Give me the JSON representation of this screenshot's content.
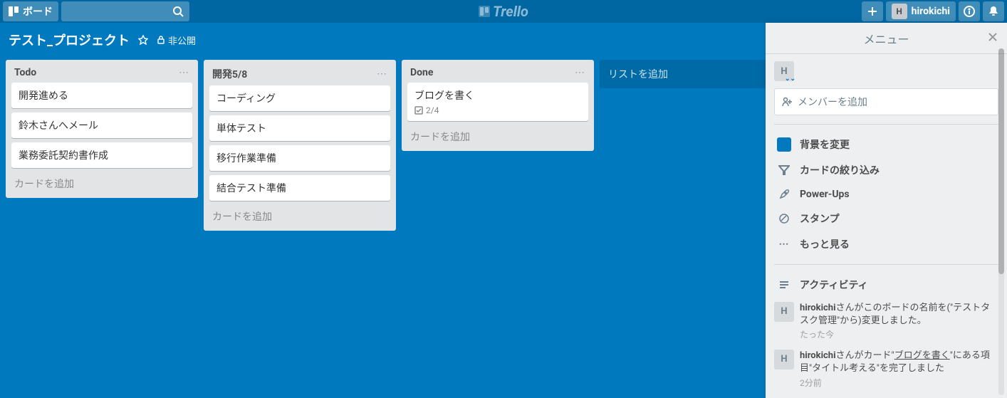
{
  "header": {
    "boards_btn": "ボード",
    "logo": "Trello",
    "user_initial": "H",
    "username": "hirokichi"
  },
  "board_header": {
    "title": "テスト_プロジェクト",
    "privacy": "非公開"
  },
  "lists": [
    {
      "title": "Todo",
      "cards": [
        {
          "text": "開発進める"
        },
        {
          "text": "鈴木さんへメール"
        },
        {
          "text": "業務委託契約書作成"
        }
      ],
      "add_label": "カードを追加"
    },
    {
      "title": "開発5/8",
      "cards": [
        {
          "text": "コーディング"
        },
        {
          "text": "単体テスト"
        },
        {
          "text": "移行作業準備"
        },
        {
          "text": "結合テスト準備"
        }
      ],
      "add_label": "カードを追加"
    },
    {
      "title": "Done",
      "cards": [
        {
          "text": "ブログを書く",
          "checklist": "2/4"
        }
      ],
      "add_label": "カードを追加"
    }
  ],
  "add_list_label": "リストを追加",
  "menu": {
    "title": "メニュー",
    "member_initial": "H",
    "add_member": "メンバーを追加",
    "items": {
      "background": "背景を変更",
      "filter": "カードの絞り込み",
      "powerups": "Power-Ups",
      "stickers": "スタンプ",
      "more": "もっと見る",
      "activity": "アクティビティ"
    },
    "activity": [
      {
        "user": "hirokichi",
        "text_before": "さんがこのボードの名前を(\"テストタスク管理\"から)変更しました。",
        "time": "たった今"
      },
      {
        "user": "hirokichi",
        "text_prefix": "さんがカード\"",
        "link": "ブログを書く",
        "text_suffix": "\"にある項目\"タイトル考える\"を完了しました",
        "time": "2分前"
      }
    ]
  }
}
